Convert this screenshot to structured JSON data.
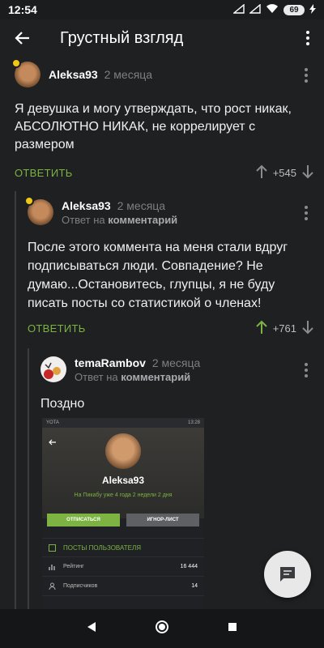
{
  "status": {
    "time": "12:54",
    "battery": "69"
  },
  "appbar": {
    "title": "Грустный взгляд"
  },
  "comments": [
    {
      "author": "Aleksa93",
      "date": "2 месяца",
      "reply_to": "",
      "text": "Я девушка и могу утверждать, что рост никак, АБСОЛЮТНО НИКАК, не коррелирует с размером",
      "reply_label": "ОТВЕТИТЬ",
      "rating": "+545"
    },
    {
      "author": "Aleksa93",
      "date": "2 месяца",
      "reply_prefix": "Ответ на",
      "reply_target": "комментарий",
      "text": "После этого коммента на меня стали вдруг подписываться люди. Совпадение? Не думаю...Остановитесь, глупцы, я не буду писать посты со статистикой о членах!",
      "reply_label": "ОТВЕТИТЬ",
      "rating": "+761"
    },
    {
      "author": "temaRambov",
      "date": "2 месяца",
      "reply_prefix": "Ответ на",
      "reply_target": "комментарий",
      "text": "Поздно"
    }
  ],
  "screenshot": {
    "status_left": "YOTA",
    "status_right": "13:28",
    "name": "Aleksa93",
    "since": "На Пикабу уже 4 года 2 недели 2 дня",
    "unsubscribe": "ОТПИСАТЬСЯ",
    "ignore": "ИГНОР-ЛИСТ",
    "posts": "ПОСТЫ ПОЛЬЗОВАТЕЛЯ",
    "rating_label": "Рейтинг",
    "rating_value": "16 444",
    "subs_label": "Подписчиков",
    "subs_value": "14"
  },
  "colors": {
    "accent": "#7cb342",
    "background": "#1e2022",
    "badge": "#f0c818"
  }
}
